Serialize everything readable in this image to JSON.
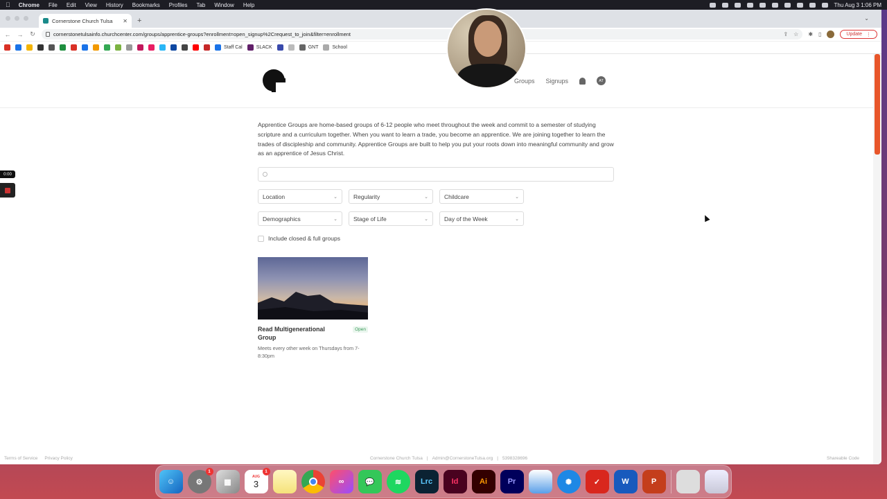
{
  "menubar": {
    "items": [
      "Chrome",
      "File",
      "Edit",
      "View",
      "History",
      "Bookmarks",
      "Profiles",
      "Tab",
      "Window",
      "Help"
    ],
    "clock": "Thu Aug 3  1:06 PM"
  },
  "browser": {
    "tab_title": "Cornerstone Church Tulsa",
    "url": "cornerstonetulsainfo.churchcenter.com/groups/apprentice-groups?enrollment=open_signup%2Crequest_to_join&filter=enrollment",
    "update_label": "Update",
    "bookmarks": {
      "staff_cal": "Staff Cal",
      "slack": "SLACK",
      "gnt": "GNT",
      "school": "School"
    }
  },
  "site": {
    "nav": {
      "groups": "Groups",
      "signups": "Signups",
      "user_initials": "AT"
    },
    "intro": "Apprentice Groups are home-based groups of 6-12 people who meet throughout the week and commit to a semester of studying scripture and a curriculum together. When you want to learn a trade, you become an apprentice. We are joining together to learn the trades of discipleship and community. Apprentice Groups are built to help you put your roots down into meaningful community and grow as an apprentice of Jesus Christ.",
    "search_placeholder": "",
    "filters": [
      "Location",
      "Regularity",
      "Childcare",
      "Demographics",
      "Stage of Life",
      "Day of the Week"
    ],
    "include_closed_label": "Include closed & full groups",
    "group_card": {
      "title": "Read Multigenerational Group",
      "status": "Open",
      "description": "Meets every other week on Thursdays from 7-8:30pm"
    },
    "footer": {
      "terms": "Terms of Service",
      "privacy": "Privacy Policy",
      "church": "Cornerstone Church Tulsa",
      "email": "Admin@CornerstoneTulsa.org",
      "phone": "5398328696",
      "shareable": "Shareable Code"
    }
  },
  "recorder": {
    "time": "0:00"
  },
  "dock": {
    "calendar_month": "AUG",
    "calendar_day": "3",
    "settings_badge": "1",
    "calendar_badge": "1",
    "apps": [
      "Lrc",
      "Id",
      "Ai",
      "Pr"
    ]
  },
  "colors": {
    "accent": "#e8562a",
    "open_badge": "#3a9a5a"
  }
}
